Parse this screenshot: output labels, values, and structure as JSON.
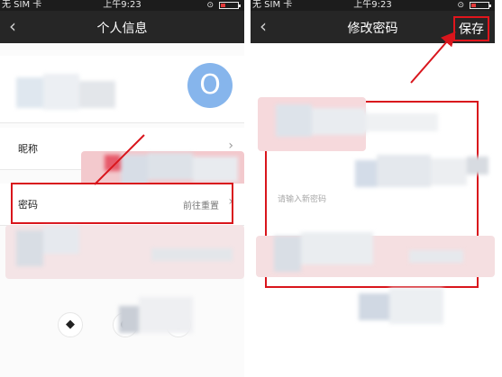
{
  "status_left": {
    "carrier": "无 SIM 卡",
    "time": "上午9:23"
  },
  "status_right": {
    "carrier": "无 SIM 卡",
    "time": "上午9:23"
  },
  "left_screen": {
    "title": "个人信息",
    "back_icon": "chevron-left-icon",
    "avatar_letter": "O",
    "rows": [
      {
        "label": "昵称",
        "value": ""
      },
      {
        "label": "密码",
        "value": "前往重置"
      }
    ]
  },
  "right_screen": {
    "title": "修改密码",
    "back_icon": "chevron-left-icon",
    "save_label": "保存",
    "new_password_placeholder": "请输入新密码"
  },
  "colors": {
    "accent": "#d9151c",
    "navbar": "#262626",
    "avatar": "#86b5ec"
  }
}
